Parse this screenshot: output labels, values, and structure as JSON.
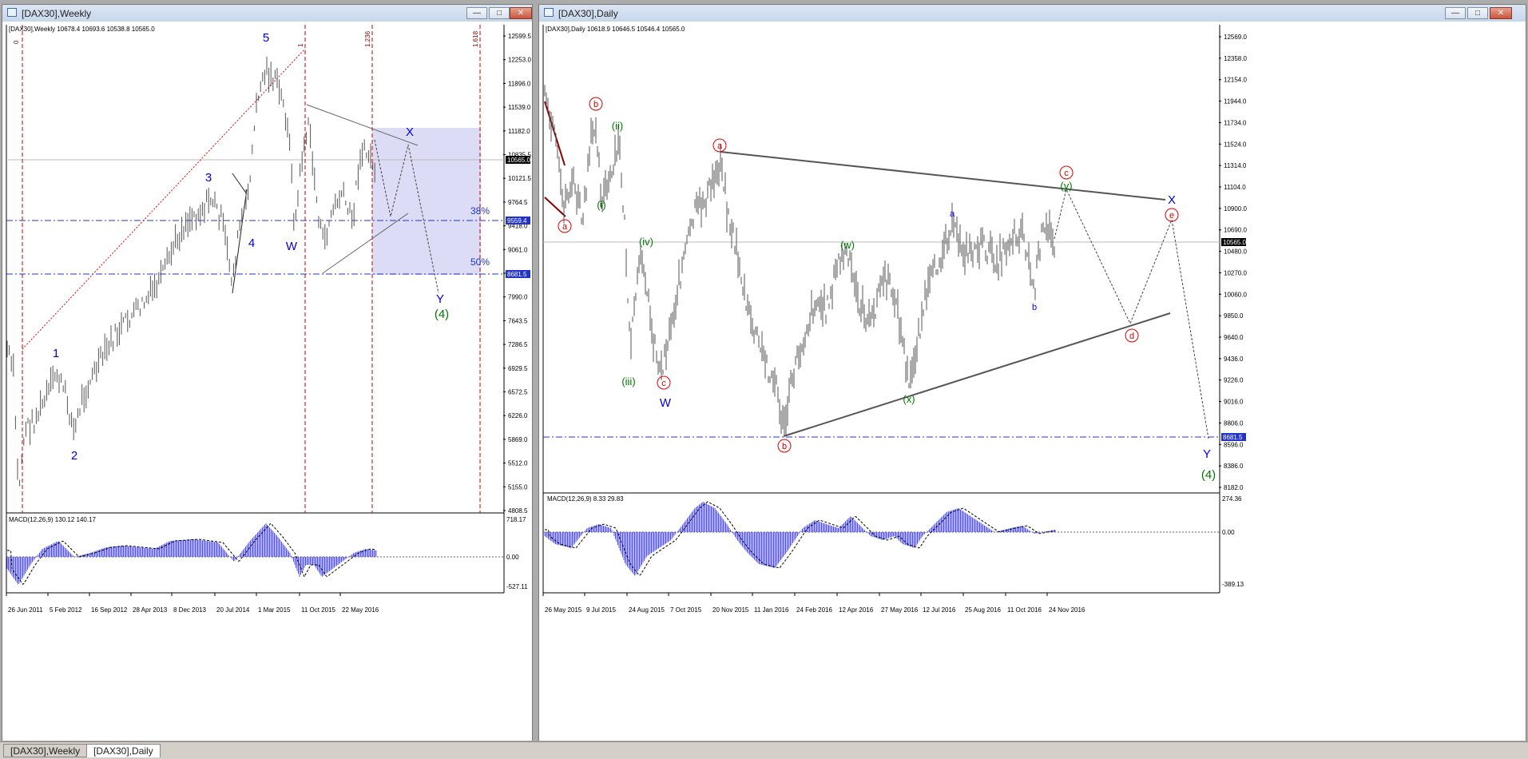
{
  "colors": {
    "wave_blue": "#0000dd",
    "wave_green": "#007700",
    "wave_red": "#d00000",
    "price_tag": "#2233cc",
    "macd": "#5555ee"
  },
  "weekly": {
    "title": "[DAX30],Weekly",
    "header": "[DAX30],Weekly  10678.4 10693.6 10538.8 10565.0",
    "macd_label": "MACD(12,26,9) 130.12 140.17",
    "price_axis": [
      "12599.5",
      "12253.0",
      "11896.0",
      "11539.0",
      "11182.0",
      "10835.5",
      "10121.5",
      "9764.5",
      "9418.0",
      "9061.0",
      "8347.0",
      "7990.0",
      "7643.5",
      "7286.5",
      "6929.5",
      "6572.5",
      "6226.0",
      "5869.0",
      "5512.0",
      "5155.0",
      "4808.5"
    ],
    "macd_axis": [
      "718.17",
      "0.00",
      "-527.11"
    ],
    "time_axis": [
      "26 Jun 2011",
      "5 Feb 2012",
      "16 Sep 2012",
      "28 Apr 2013",
      "8 Dec 2013",
      "20 Jul 2014",
      "1 Mar 2015",
      "11 Oct 2015",
      "22 May 2016"
    ],
    "price_tags": {
      "current": "10565.0",
      "fib38": "9559.4",
      "fib50": "8681.5"
    },
    "fib_labels": {
      "f0": "0",
      "f1": "1",
      "f1236": "1.236",
      "f1618": "1.618",
      "p38": "38%",
      "p50": "50%"
    },
    "waves": {
      "w1": "1",
      "w2": "2",
      "w3": "3",
      "w4": "4",
      "w5": "5",
      "W": "W",
      "X": "X",
      "Y": "Y",
      "four": "(4)"
    }
  },
  "daily": {
    "title": "[DAX30],Daily",
    "header": "[DAX30],Daily  10618.9 10646.5 10546.4 10565.0",
    "macd_label": "MACD(12,26,9) 8.33 29.83",
    "price_axis": [
      "12569.0",
      "12358.0",
      "12154.0",
      "11944.0",
      "11734.0",
      "11524.0",
      "11314.0",
      "11104.0",
      "10900.0",
      "10690.0",
      "10480.0",
      "10270.0",
      "10060.0",
      "9850.0",
      "9640.0",
      "9436.0",
      "9226.0",
      "9016.0",
      "8806.0",
      "8596.0",
      "8386.0",
      "8182.0"
    ],
    "macd_axis": [
      "274.36",
      "0.00",
      "-389.13"
    ],
    "time_axis": [
      "26 May 2015",
      "9 Jul 2015",
      "24 Aug 2015",
      "7 Oct 2015",
      "20 Nov 2015",
      "11 Jan 2016",
      "24 Feb 2016",
      "12 Apr 2016",
      "27 May 2016",
      "12 Jul 2016",
      "25 Aug 2016",
      "11 Oct 2016",
      "24 Nov 2016"
    ],
    "price_tags": {
      "current": "10565.0",
      "fib50": "8681.5"
    },
    "waves": {
      "a_red": "a",
      "b_red": "b",
      "c_red": "c",
      "d_red": "d",
      "e_red": "e",
      "b_red2": "b",
      "a_red2": "a",
      "c_red2": "c",
      "i": "(i)",
      "ii": "(ii)",
      "iii": "(iii)",
      "iv": "(iv)",
      "w": "(w)",
      "x": "(x)",
      "y": "(y)",
      "W": "W",
      "X": "X",
      "Y": "Y",
      "four": "(4)",
      "a_blue": "a",
      "b_blue": "b"
    }
  },
  "taskbar": {
    "tab_weekly": "[DAX30],Weekly",
    "tab_daily": "[DAX30],Daily"
  }
}
